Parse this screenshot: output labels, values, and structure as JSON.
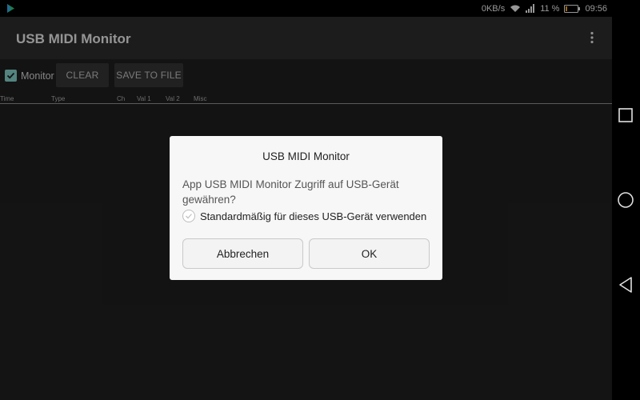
{
  "status_bar": {
    "speed": "0KB/s",
    "battery_percent": "11 %",
    "time": "09:56"
  },
  "app_bar": {
    "title": "USB MIDI Monitor"
  },
  "toolbar": {
    "monitor_label": "Monitor",
    "monitor_checked": true,
    "clear_label": "CLEAR",
    "save_label": "SAVE TO FILE"
  },
  "table": {
    "columns": [
      "Time",
      "Type",
      "Ch",
      "Val 1",
      "Val 2",
      "Misc"
    ]
  },
  "dialog": {
    "title": "USB MIDI Monitor",
    "message": "App USB MIDI Monitor Zugriff auf USB-Gerät gewähren?",
    "default_label": "Standardmäßig für dieses USB-Gerät verwenden",
    "cancel_label": "Abbrechen",
    "ok_label": "OK"
  },
  "colors": {
    "accent": "#80cbc4",
    "background": "#1e1e1e"
  }
}
